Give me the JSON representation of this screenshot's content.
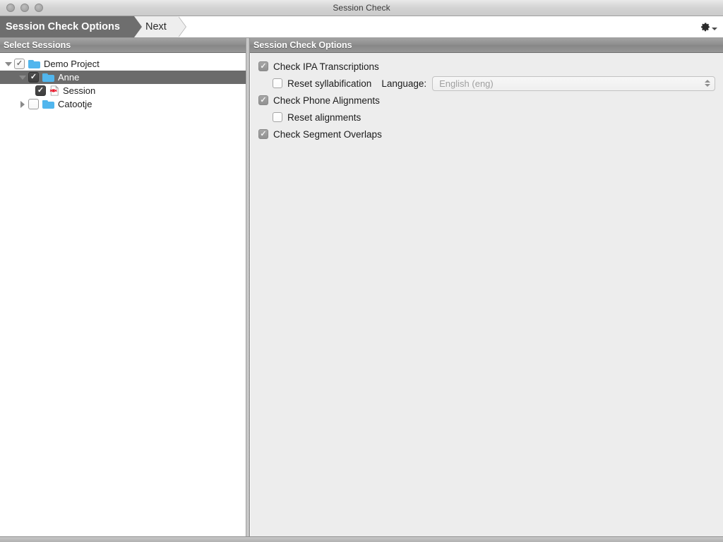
{
  "window": {
    "title": "Session Check",
    "controls": [
      "close-button",
      "minimize-button",
      "zoom-button"
    ]
  },
  "toolbar": {
    "breadcrumbs": [
      {
        "label": "Session Check Options",
        "active": true
      },
      {
        "label": "Next",
        "active": false
      }
    ],
    "gear_icon": "gear-icon"
  },
  "left_panel": {
    "header": "Select Sessions",
    "tree": [
      {
        "label": "Demo Project",
        "icon": "folder-icon",
        "checkbox": "checked-light",
        "twisty": "expanded",
        "selected": false,
        "depth": 1
      },
      {
        "label": "Anne",
        "icon": "folder-icon",
        "checkbox": "checked-dark",
        "twisty": "expanded",
        "selected": true,
        "depth": 2
      },
      {
        "label": "Session",
        "icon": "session-document-icon",
        "checkbox": "checked-dark",
        "twisty": "none",
        "selected": false,
        "depth": 3
      },
      {
        "label": "Catootje",
        "icon": "folder-icon",
        "checkbox": "unchecked",
        "twisty": "collapsed",
        "selected": false,
        "depth": 2
      }
    ]
  },
  "right_panel": {
    "header": "Session Check Options",
    "options": [
      {
        "label": "Check IPA Transcriptions",
        "checked": true,
        "depth": 1
      },
      {
        "label": "Reset syllabification",
        "checked": false,
        "depth": 2
      },
      {
        "label": "Check Phone Alignments",
        "checked": true,
        "depth": 1
      },
      {
        "label": "Reset alignments",
        "checked": false,
        "depth": 2
      },
      {
        "label": "Check Segment Overlaps",
        "checked": true,
        "depth": 1
      }
    ],
    "language": {
      "label": "Language:",
      "value": "English (eng)",
      "enabled": false
    }
  },
  "colors": {
    "accent_folder": "#51b6ee",
    "selection": "#6b6b6b",
    "header_bar": "#8d8d8d",
    "breadcrumb_active": "#6e6e6e",
    "session_icon_red": "#e8192c"
  }
}
